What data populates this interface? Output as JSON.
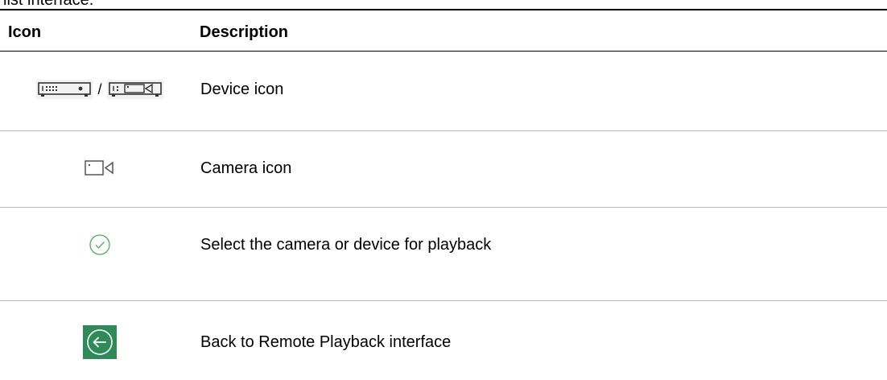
{
  "caption_fragment": "list interface.",
  "table": {
    "headers": {
      "icon": "Icon",
      "description": "Description"
    },
    "rows": [
      {
        "icon": "device-icon (nvr-box / camera-box)",
        "separator": "/",
        "description": "Device icon"
      },
      {
        "icon": "camera-icon",
        "description": "Camera icon"
      },
      {
        "icon": "check-circle-icon",
        "description": "Select the camera or device for playback"
      },
      {
        "icon": "back-arrow-icon",
        "description": "Back to Remote Playback interface"
      }
    ]
  },
  "colors": {
    "check_green": "#4caf50",
    "back_button_bg": "#2e8b57",
    "divider": "#bdbdbd"
  }
}
